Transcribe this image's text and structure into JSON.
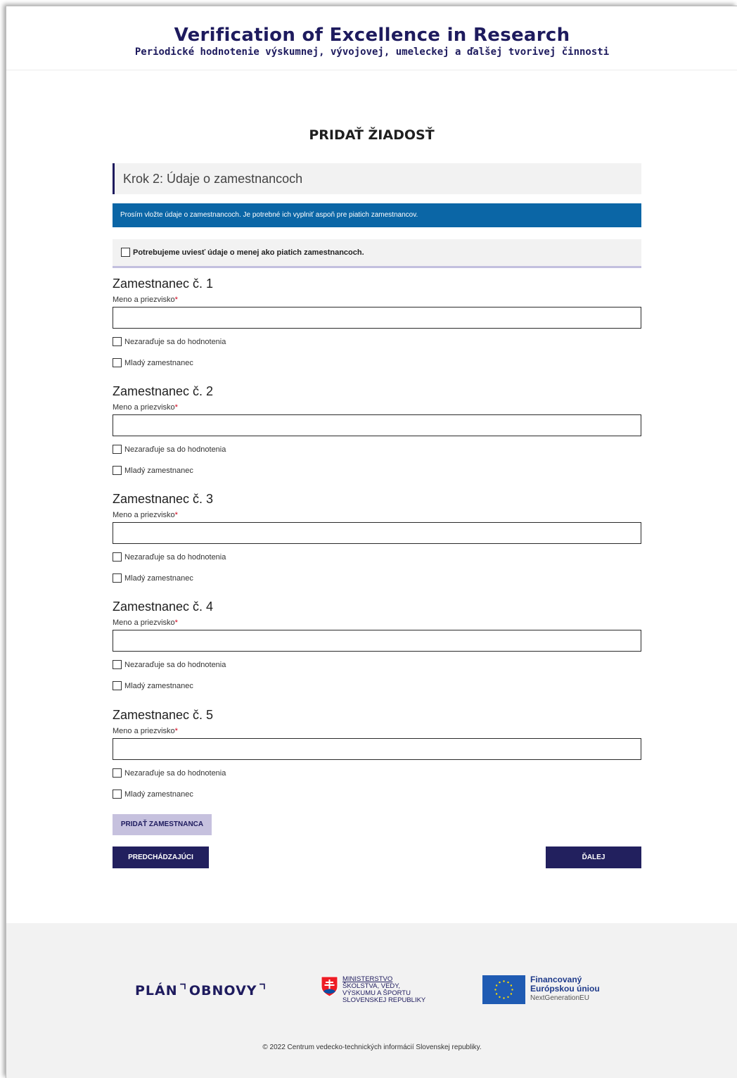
{
  "header": {
    "title": "Verification of Excellence in Research",
    "subtitle": "Periodické hodnotenie výskumnej, vývojovej, umeleckej a ďalšej tvorivej činnosti"
  },
  "page_heading": "PRIDAŤ ŽIADOSŤ",
  "step": "Krok 2: Údaje o zamestnancoch",
  "info": "Prosím vložte údaje o zamestnancoch. Je potrebné ich vyplniť aspoň pre piatich zamestnancov.",
  "fewer_checkbox": "Potrebujeme uviesť údaje o menej ako piatich zamestnancoch.",
  "employees": [
    {
      "title": "Zamestnanec č. 1",
      "label": "Meno a priezvisko",
      "required_mark": "*",
      "value": "",
      "check_excluded": "Nezaraďuje sa do hodnotenia",
      "check_young": "Mladý zamestnanec"
    },
    {
      "title": "Zamestnanec č. 2",
      "label": "Meno a priezvisko",
      "required_mark": "*",
      "value": "",
      "check_excluded": "Nezaraďuje sa do hodnotenia",
      "check_young": "Mladý zamestnanec"
    },
    {
      "title": "Zamestnanec č. 3",
      "label": "Meno a priezvisko",
      "required_mark": "*",
      "value": "",
      "check_excluded": "Nezaraďuje sa do hodnotenia",
      "check_young": "Mladý zamestnanec"
    },
    {
      "title": "Zamestnanec č. 4",
      "label": "Meno a priezvisko",
      "required_mark": "*",
      "value": "",
      "check_excluded": "Nezaraďuje sa do hodnotenia",
      "check_young": "Mladý zamestnanec"
    },
    {
      "title": "Zamestnanec č. 5",
      "label": "Meno a priezvisko",
      "required_mark": "*",
      "value": "",
      "check_excluded": "Nezaraďuje sa do hodnotenia",
      "check_young": "Mladý zamestnanec"
    }
  ],
  "buttons": {
    "add_employee": "PRIDAŤ ZAMESTNANCA",
    "previous": "PREDCHÁDZAJÚCI",
    "next": "ĎALEJ"
  },
  "footer": {
    "plan_logo": {
      "word1": "PLÁN",
      "word2": "OBNOVY"
    },
    "ministry_logo": {
      "line1": "MINISTERSTVO",
      "line2": "ŠKOLSTVA, VEDY,",
      "line3": "VÝSKUMU A ŠPORTU",
      "line4": "SLOVENSKEJ REPUBLIKY"
    },
    "eu_logo": {
      "line1": "Financovaný",
      "line2": "Európskou úniou",
      "line3": "NextGenerationEU"
    },
    "copyright": "© 2022 Centrum vedecko-technických informácií Slovenskej republiky."
  },
  "colors": {
    "brand_navy": "#1e1b5e",
    "info_blue": "#0b66a6",
    "add_button_bg": "#c6c1de",
    "eu_blue": "#1f5bb3"
  }
}
